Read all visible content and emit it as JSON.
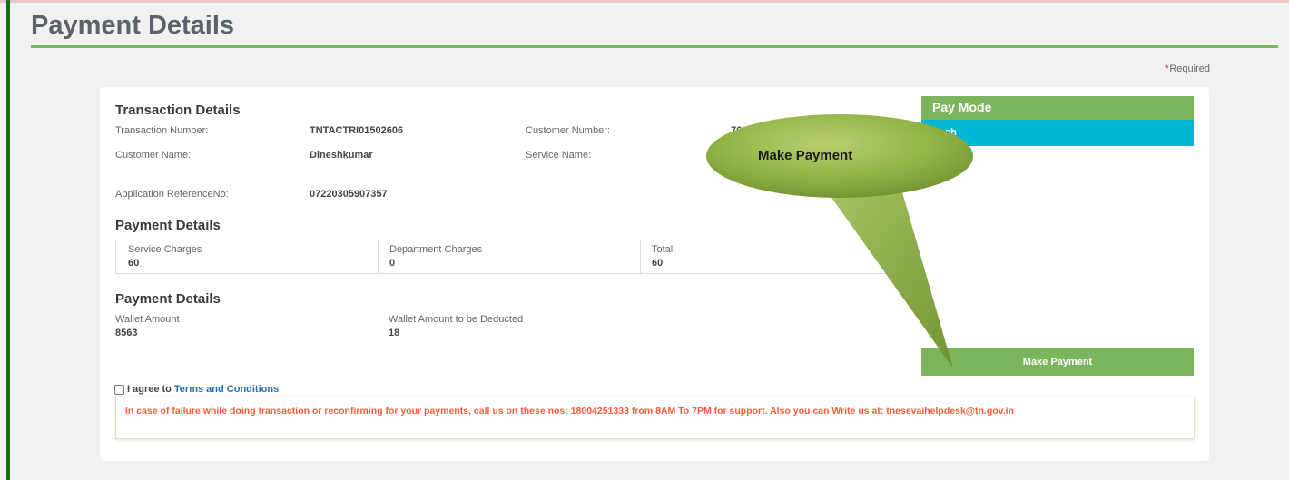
{
  "page": {
    "title": "Payment Details",
    "required_label": "Required"
  },
  "transaction": {
    "heading": "Transaction Details",
    "transaction_number_label": "Transaction Number:",
    "transaction_number": "TNTACTRI01502606",
    "customer_number_label": "Customer Number:",
    "customer_number_partial": "76",
    "customer_name_label": "Customer Name:",
    "customer_name": "Dineshkumar",
    "service_name_label": "Service Name:",
    "app_ref_label": "Application ReferenceNo:",
    "app_ref": "07220305907357"
  },
  "charges": {
    "heading": "Payment Details",
    "service_label": "Service Charges",
    "service_value": "60",
    "department_label": "Department Charges",
    "department_value": "0",
    "total_label": "Total",
    "total_value": "60"
  },
  "wallet": {
    "heading": "Payment Details",
    "amount_label": "Wallet Amount",
    "amount_value": "8563",
    "deduct_label": "Wallet Amount to be Deducted",
    "deduct_value": "18"
  },
  "paymode": {
    "heading": "Pay Mode",
    "option": "Cash"
  },
  "actions": {
    "make_payment": "Make Payment"
  },
  "terms": {
    "agree_text": "I agree to",
    "link_text": "Terms and Conditions"
  },
  "notice": {
    "text": "In case of failure while doing transaction or reconfirming for your payments, call us on these nos: 18004251333 from 8AM To 7PM for support. Also you can Write us at: tnesevaihelpdesk@tn.gov.in"
  },
  "callout": {
    "text": "Make Payment"
  },
  "colors": {
    "accent_green": "#7bb55e",
    "paymode_option": "#00b7d6",
    "notice_text": "#ff5a3a",
    "left_bar": "#1c6b1c"
  }
}
